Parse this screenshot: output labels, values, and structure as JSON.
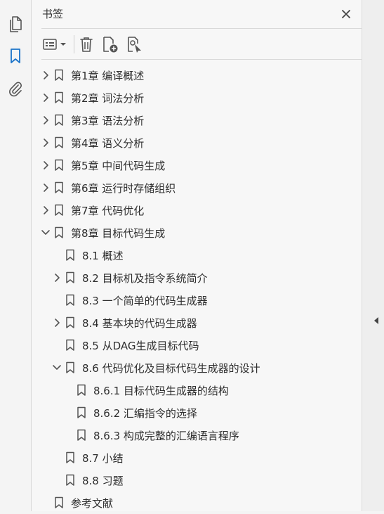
{
  "panel": {
    "title": "书签"
  },
  "rail": {
    "items": [
      {
        "icon": "pages-icon"
      },
      {
        "icon": "bookmark-icon",
        "active": true
      },
      {
        "icon": "attachment-icon"
      }
    ]
  },
  "toolbar": {
    "items": [
      "options-menu-icon",
      "delete-icon",
      "new-bookmark-icon",
      "new-bookmark-from-structure-icon"
    ]
  },
  "colors": {
    "accent": "#1a73c9",
    "icon": "#555555",
    "text": "#2e2e2e"
  },
  "bookmarks": [
    {
      "label": "第1章 编译概述",
      "level": 0,
      "expander": "collapsed"
    },
    {
      "label": "第2章 词法分析",
      "level": 0,
      "expander": "collapsed"
    },
    {
      "label": "第3章 语法分析",
      "level": 0,
      "expander": "collapsed"
    },
    {
      "label": "第4章 语义分析",
      "level": 0,
      "expander": "collapsed"
    },
    {
      "label": "第5章 中间代码生成",
      "level": 0,
      "expander": "collapsed"
    },
    {
      "label": "第6章 运行时存储组织",
      "level": 0,
      "expander": "collapsed"
    },
    {
      "label": "第7章 代码优化",
      "level": 0,
      "expander": "collapsed"
    },
    {
      "label": "第8章 目标代码生成",
      "level": 0,
      "expander": "expanded"
    },
    {
      "label": "8.1 概述",
      "level": 1,
      "expander": "none"
    },
    {
      "label": "8.2 目标机及指令系统简介",
      "level": 1,
      "expander": "collapsed"
    },
    {
      "label": "8.3 一个简单的代码生成器",
      "level": 1,
      "expander": "none"
    },
    {
      "label": "8.4 基本块的代码生成器",
      "level": 1,
      "expander": "collapsed"
    },
    {
      "label": "8.5 从DAG生成目标代码",
      "level": 1,
      "expander": "none"
    },
    {
      "label": "8.6 代码优化及目标代码生成器的设计",
      "level": 1,
      "expander": "expanded"
    },
    {
      "label": "8.6.1 目标代码生成器的结构",
      "level": 2,
      "expander": "none"
    },
    {
      "label": "8.6.2 汇编指令的选择",
      "level": 2,
      "expander": "none"
    },
    {
      "label": "8.6.3 构成完整的汇编语言程序",
      "level": 2,
      "expander": "none"
    },
    {
      "label": "8.7 小结",
      "level": 1,
      "expander": "none"
    },
    {
      "label": "8.8 习题",
      "level": 1,
      "expander": "none"
    },
    {
      "label": "参考文献",
      "level": 0,
      "expander": "none"
    }
  ]
}
